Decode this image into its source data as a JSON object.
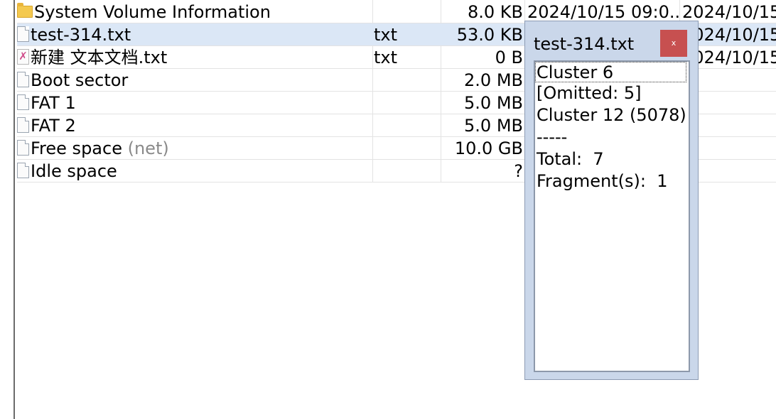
{
  "file_list": {
    "rows": [
      {
        "name": "System Volume Information",
        "ext": "",
        "size": "8.0 KB",
        "created": "2024/10/15  09:0...",
        "modified": "2024/10/15",
        "icon": "folder-icon"
      },
      {
        "name": "test-314.txt",
        "ext": "txt",
        "size": "53.0 KB",
        "created": "",
        "modified": "2024/10/15",
        "icon": "text-file-icon"
      },
      {
        "name": "新建 文本文档.txt",
        "ext": "txt",
        "size": "0 B",
        "created": "",
        "modified": "2024/10/15",
        "icon": "deleted-file-icon"
      },
      {
        "name": "Boot sector",
        "ext": "",
        "size": "2.0 MB",
        "created": "",
        "modified": "",
        "icon": "file-icon"
      },
      {
        "name": "FAT 1",
        "ext": "",
        "size": "5.0 MB",
        "created": "",
        "modified": "",
        "icon": "file-icon"
      },
      {
        "name": "FAT 2",
        "ext": "",
        "size": "5.0 MB",
        "created": "",
        "modified": "",
        "icon": "file-icon"
      },
      {
        "name": "Free space",
        "name_suffix": "(net)",
        "ext": "",
        "size": "10.0 GB",
        "created": "",
        "modified": "",
        "icon": "file-icon"
      },
      {
        "name": "Idle space",
        "ext": "",
        "size": "?",
        "created": "",
        "modified": "",
        "icon": "file-icon"
      }
    ]
  },
  "popup": {
    "title": "test-314.txt",
    "close_label": "x",
    "items": [
      "Cluster 6",
      "[Omitted: 5]",
      "Cluster 12 (5078)",
      "-----",
      "Total:  7",
      "Fragment(s):  1"
    ]
  },
  "colors": {
    "selected_row": "#dbe7f6",
    "popup_frame": "#cad7ea",
    "close_button": "#c75050",
    "folder": "#f4c94f"
  }
}
